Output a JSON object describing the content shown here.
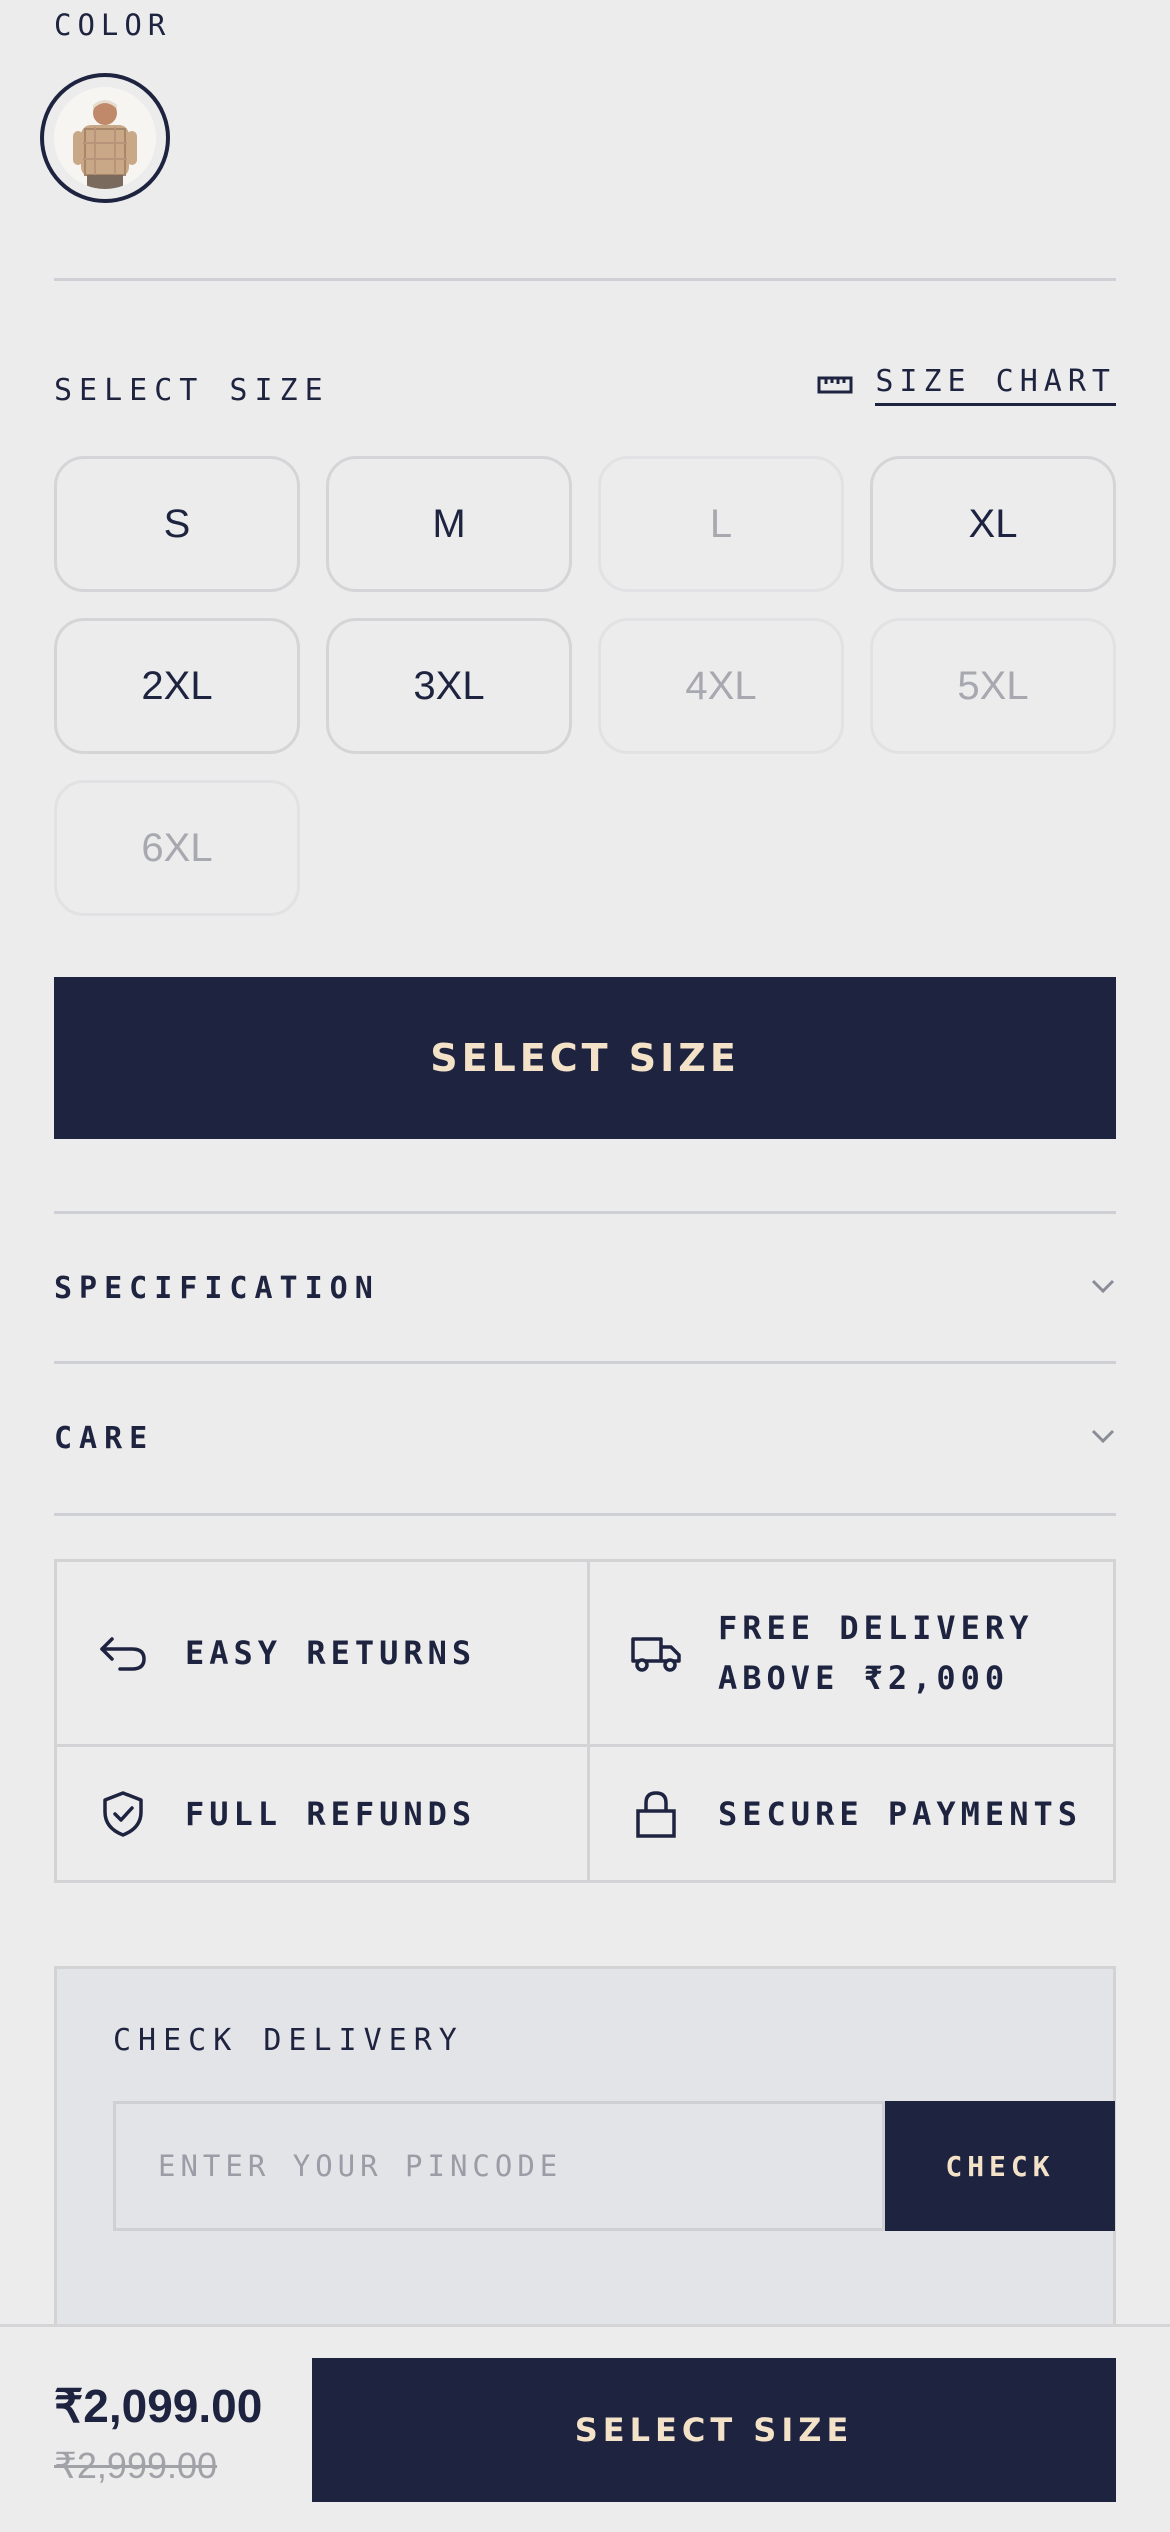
{
  "color": {
    "label": "COLOR"
  },
  "size_section": {
    "title": "SELECT SIZE",
    "chart_label": "SIZE CHART",
    "sizes": [
      {
        "label": "S",
        "available": true
      },
      {
        "label": "M",
        "available": true
      },
      {
        "label": "L",
        "available": false
      },
      {
        "label": "XL",
        "available": true
      },
      {
        "label": "2XL",
        "available": true
      },
      {
        "label": "3XL",
        "available": true
      },
      {
        "label": "4XL",
        "available": false
      },
      {
        "label": "5XL",
        "available": false
      },
      {
        "label": "6XL",
        "available": false
      }
    ]
  },
  "primary_button": "SELECT SIZE",
  "accordions": [
    {
      "label": "SPECIFICATION"
    },
    {
      "label": "CARE"
    }
  ],
  "features": {
    "returns": "EASY RETURNS",
    "delivery_line1": "FREE DELIVERY",
    "delivery_line2": "ABOVE ₹2,000",
    "refunds": "FULL REFUNDS",
    "payments": "SECURE PAYMENTS"
  },
  "check_delivery": {
    "title": "CHECK DELIVERY",
    "placeholder": "ENTER YOUR PINCODE",
    "button": "CHECK"
  },
  "bottom_bar": {
    "price": "₹2,099.00",
    "mrp": "₹2,999.00",
    "button": "SELECT SIZE"
  },
  "colors": {
    "navy": "#1e2340",
    "cream": "#f3e2c8",
    "background": "#ececec"
  }
}
